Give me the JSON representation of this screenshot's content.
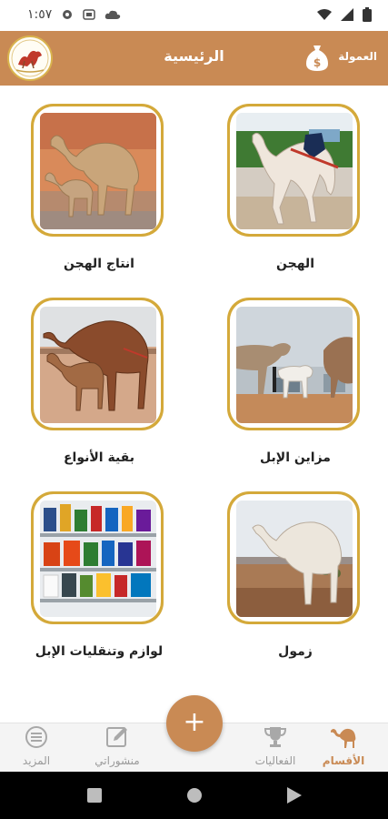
{
  "status_bar": {
    "time": "١:٥٧"
  },
  "app_bar": {
    "title": "الرئيسية",
    "commission_label": "العمولة",
    "commission_icon": "money-bag-icon",
    "logo_icon": "app-logo-icon"
  },
  "categories": [
    {
      "label": "الهجن",
      "icon": "racing-camel-photo"
    },
    {
      "label": "انتاج الهجن",
      "icon": "camel-with-calf-photo"
    },
    {
      "label": "مزاين الإبل",
      "icon": "camel-beauty-contest-photo"
    },
    {
      "label": "بقية الأنواع",
      "icon": "camel-herd-photo"
    },
    {
      "label": "زمول",
      "icon": "white-camel-photo"
    },
    {
      "label": "لوازم وتنقليات الإبل",
      "icon": "camel-supplies-shelf-photo"
    }
  ],
  "bottom_nav": {
    "items": [
      {
        "label": "الأقسام",
        "icon": "camel-icon",
        "active": true
      },
      {
        "label": "الفعاليات",
        "icon": "trophy-icon",
        "active": false
      },
      {
        "label": "منشوراتي",
        "icon": "edit-icon",
        "active": false
      },
      {
        "label": "المزيد",
        "icon": "menu-icon",
        "active": false
      }
    ],
    "fab_label": "+"
  },
  "colors": {
    "primary": "#c98a54",
    "gold": "#d4a93a",
    "text": "#222222",
    "inactive": "#9a9a9a"
  }
}
